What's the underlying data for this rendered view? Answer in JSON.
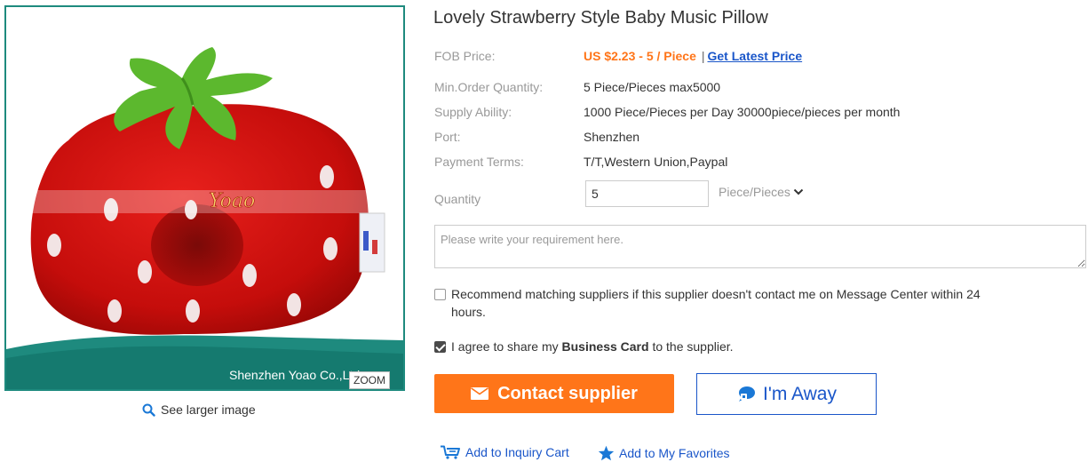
{
  "product": {
    "title": "Lovely Strawberry Style Baby Music Pillow",
    "image_watermark": "Shenzhen Yoao Co.,Ltd",
    "zoom_label": "ZOOM",
    "see_larger_label": "See larger image"
  },
  "details": {
    "fob_label": "FOB Price:",
    "fob_value": "US $2.23 - 5 / Piece",
    "fob_separator": "|",
    "latest_price_link": "Get Latest Price",
    "min_order_label": "Min.Order Quantity:",
    "min_order_value": "5 Piece/Pieces max5000",
    "supply_label": "Supply Ability:",
    "supply_value": "1000 Piece/Pieces per Day 30000piece/pieces per month",
    "port_label": "Port:",
    "port_value": "Shenzhen",
    "payment_label": "Payment Terms:",
    "payment_value": "T/T,Western Union,Paypal"
  },
  "inquiry": {
    "quantity_label": "Quantity",
    "quantity_value": "5",
    "unit_value": "Piece/Pieces",
    "requirement_placeholder": "Please write your requirement here.",
    "recommend_text_line1": "Recommend matching suppliers if this supplier doesn't contact me on Message Center within 24",
    "recommend_text_line2": "hours.",
    "recommend_checked": false,
    "agree_prefix": "I agree to share my ",
    "agree_bold": "Business Card",
    "agree_suffix": " to the supplier.",
    "agree_checked": true
  },
  "actions": {
    "contact_label": "Contact supplier",
    "away_label": "I'm Away",
    "inquiry_cart_label": "Add to Inquiry Cart",
    "favorites_label": "Add to My Favorites"
  },
  "colors": {
    "accent_orange": "#ff7519",
    "link_blue": "#1a56c9",
    "label_gray": "#999999",
    "frame_teal": "#1e8a7e"
  }
}
